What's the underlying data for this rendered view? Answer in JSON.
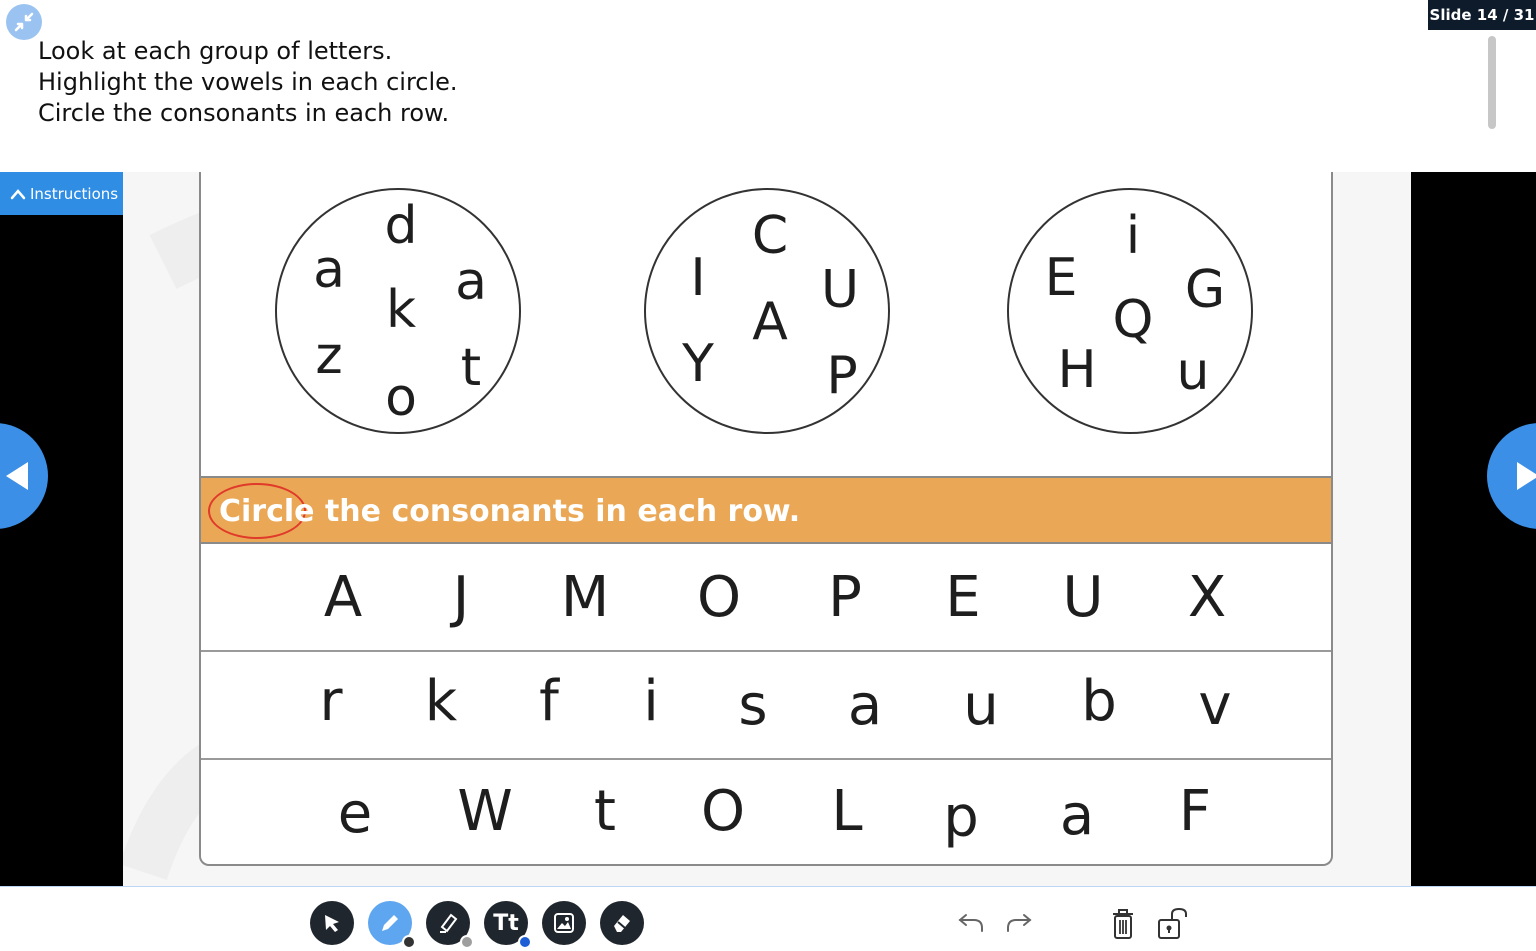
{
  "header": {
    "instructions": [
      "Look at each group of letters.",
      "Highlight the vowels in each circle.",
      "Circle the consonants in each row."
    ],
    "slide_counter": "Slide 14 / 31",
    "instructions_tab_label": "Instructions"
  },
  "worksheet": {
    "circles": [
      {
        "letters": [
          "d",
          "a",
          "a",
          "k",
          "z",
          "t",
          "o"
        ]
      },
      {
        "letters": [
          "C",
          "I",
          "U",
          "A",
          "Y",
          "P"
        ]
      },
      {
        "letters": [
          "i",
          "E",
          "G",
          "Q",
          "H",
          "u"
        ]
      }
    ],
    "banner_circled_word": "Circle",
    "banner_rest": " the consonants in each row.",
    "rows": [
      [
        "A",
        "J",
        "M",
        "O",
        "P",
        "E",
        "U",
        "X"
      ],
      [
        "r",
        "k",
        "f",
        "i",
        "s",
        "a",
        "u",
        "b",
        "v"
      ],
      [
        "e",
        "W",
        "t",
        "O",
        "L",
        "p",
        "a",
        "F"
      ]
    ]
  },
  "toolbar": {
    "tools": [
      "select-tool",
      "pen-tool",
      "highlighter-tool",
      "text-tool",
      "image-tool",
      "eraser-tool"
    ],
    "pen_color": "#333333",
    "highlighter_color": "#9e9e9e",
    "text_color": "#1f5fd6",
    "actions": [
      "undo",
      "redo",
      "delete",
      "lock"
    ]
  },
  "colors": {
    "banner": "#eaa755",
    "accent_blue": "#2f8de4",
    "circle_mark": "#e03a2a"
  }
}
